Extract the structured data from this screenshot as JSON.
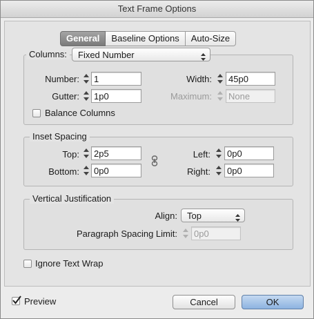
{
  "window": {
    "title": "Text Frame Options"
  },
  "tabs": [
    {
      "label": "General",
      "active": true
    },
    {
      "label": "Baseline Options",
      "active": false
    },
    {
      "label": "Auto-Size",
      "active": false
    }
  ],
  "columns": {
    "label": "Columns:",
    "type": "Fixed Number",
    "number_label": "Number:",
    "number_value": "1",
    "width_label": "Width:",
    "width_value": "45p0",
    "gutter_label": "Gutter:",
    "gutter_value": "1p0",
    "maximum_label": "Maximum:",
    "maximum_value": "None",
    "balance_label": "Balance Columns",
    "balance_checked": false
  },
  "inset": {
    "legend": "Inset Spacing",
    "top_label": "Top:",
    "top_value": "2p5",
    "bottom_label": "Bottom:",
    "bottom_value": "0p0",
    "left_label": "Left:",
    "left_value": "0p0",
    "right_label": "Right:",
    "right_value": "0p0"
  },
  "vertical": {
    "legend": "Vertical Justification",
    "align_label": "Align:",
    "align_value": "Top",
    "spacing_label": "Paragraph Spacing Limit:",
    "spacing_value": "0p0"
  },
  "ignore_wrap": {
    "label": "Ignore Text Wrap",
    "checked": false
  },
  "preview": {
    "label": "Preview",
    "checked": true
  },
  "buttons": {
    "cancel": "Cancel",
    "ok": "OK"
  },
  "colors": {
    "ok_button": "#8db3e0",
    "active_tab": "#7a7a7a"
  },
  "icons": {
    "spinner": "stepper-arrows-icon",
    "link": "chain-link-icon",
    "check": "checkmark-icon",
    "popup": "up-down-chevron-icon"
  }
}
